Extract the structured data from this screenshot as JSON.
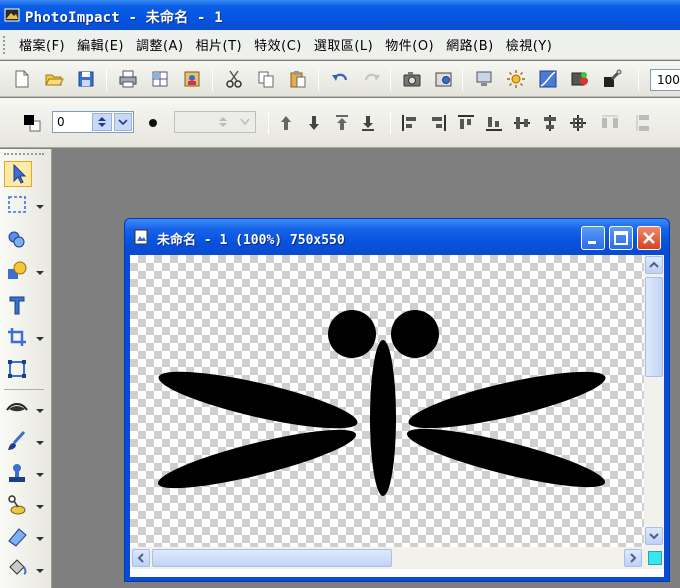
{
  "app": {
    "title": "PhotoImpact - 未命名 - 1"
  },
  "menubar": {
    "items": [
      "檔案(F)",
      "編輯(E)",
      "調整(A)",
      "相片(T)",
      "特效(C)",
      "選取區(L)",
      "物件(O)",
      "網路(B)",
      "檢視(Y)"
    ]
  },
  "toolbar": {
    "zoom_value": "100"
  },
  "attribute_bar": {
    "size_value": "0"
  },
  "document": {
    "title": "未命名 - 1 (100%) 750x550"
  },
  "colors": {
    "accent": "#0554e3",
    "dragonfly": "#000000",
    "swatch": "#39e6f0"
  }
}
